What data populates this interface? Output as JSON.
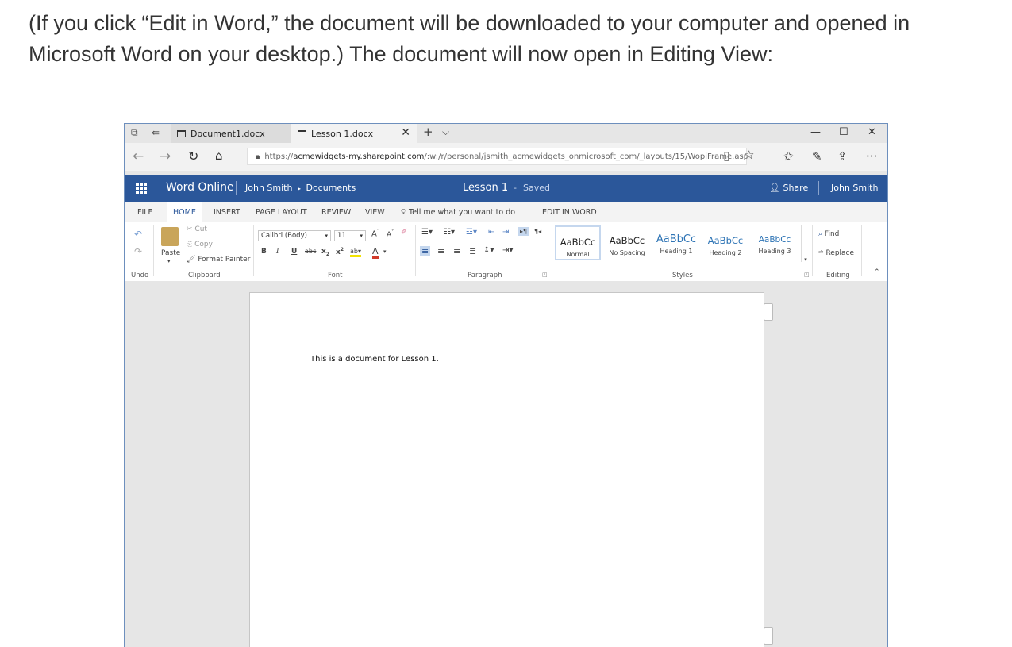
{
  "intro": {
    "line1": "(If you click “Edit in Word,” the document will be downloaded to your computer and opened in",
    "line2": "Microsoft Word on your desktop.) The document will now open in Editing View:"
  },
  "browser": {
    "tabs": [
      {
        "label": "Document1.docx"
      },
      {
        "label": "Lesson 1.docx"
      }
    ],
    "new_tab": "+",
    "tab_menu": "⌵",
    "window_controls": {
      "minimize": "—",
      "maximize": "☐",
      "close": "✕"
    },
    "url_scheme": "https://",
    "url_host": "acmewidgets-my.sharepoint.com",
    "url_path": "/:w:/r/personal/jsmith_acmewidgets_onmicrosoft_com/_layouts/15/WopiFrame.aspx?",
    "more": "···"
  },
  "word": {
    "app_name": "Word Online",
    "owner": "John Smith",
    "crumb_sep": "▸",
    "folder": "Documents",
    "doc_name": "Lesson 1",
    "status_sep": "-",
    "status": "Saved",
    "share_label": "Share",
    "user_name": "John Smith"
  },
  "ribbon_tabs": [
    "FILE",
    "HOME",
    "INSERT",
    "PAGE LAYOUT",
    "REVIEW",
    "VIEW"
  ],
  "tell_me": "Tell me what you want to do",
  "edit_in_word": "EDIT IN WORD",
  "ribbon": {
    "undo_group": "Undo",
    "clipboard": {
      "paste": "Paste",
      "cut": "Cut",
      "copy": "Copy",
      "format_painter": "Format Painter",
      "group": "Clipboard"
    },
    "font": {
      "family": "Calibri (Body)",
      "size": "11",
      "group": "Font"
    },
    "paragraph_group": "Paragraph",
    "styles": [
      {
        "preview": "AaBbCc",
        "name": "Normal"
      },
      {
        "preview": "AaBbCc",
        "name": "No Spacing"
      },
      {
        "preview": "AaBbCc",
        "name": "Heading 1"
      },
      {
        "preview": "AaBbCc",
        "name": "Heading 2"
      },
      {
        "preview": "AaBbCc",
        "name": "Heading 3"
      }
    ],
    "styles_group": "Styles",
    "editing": {
      "find": "Find",
      "replace": "Replace",
      "group": "Editing"
    }
  },
  "document": {
    "body": "This is a document for Lesson 1."
  }
}
